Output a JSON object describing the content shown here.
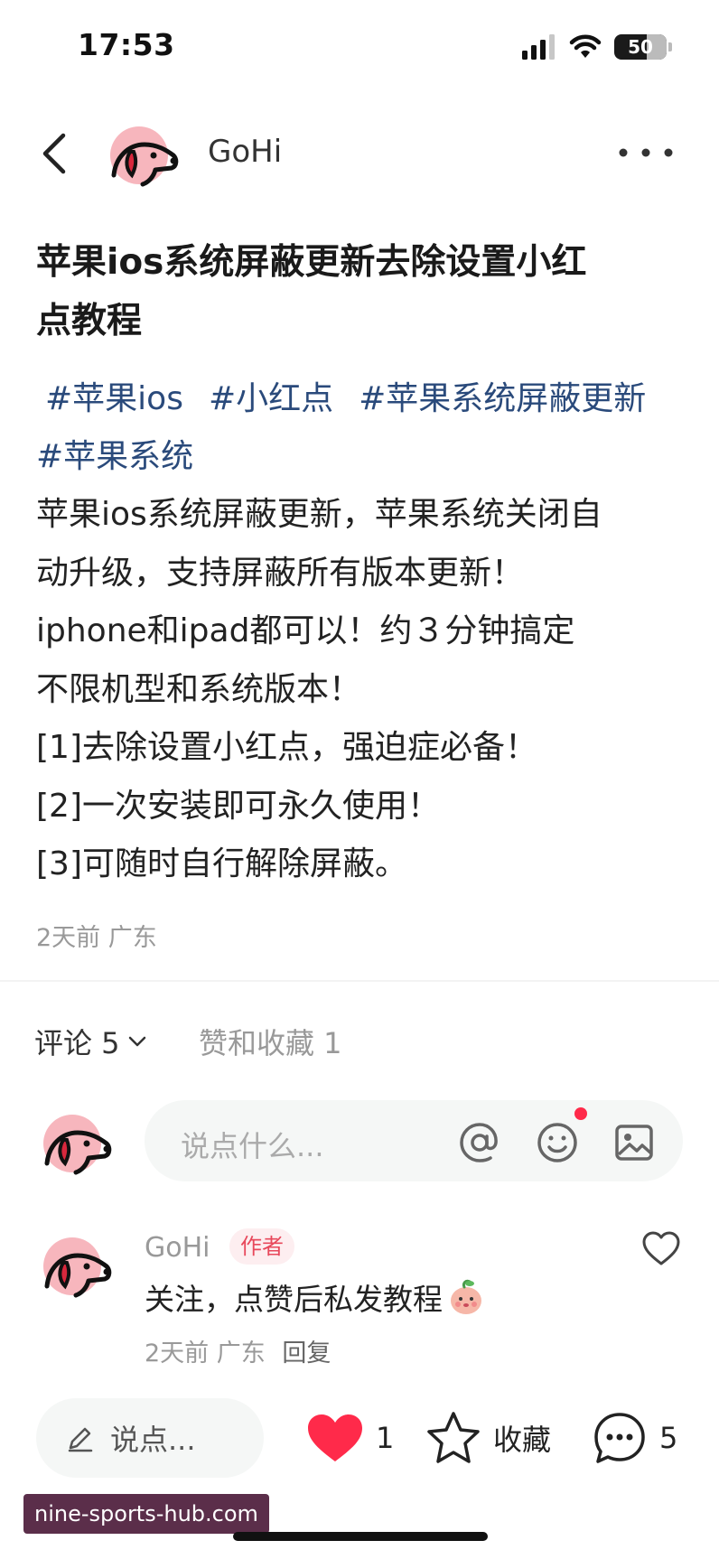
{
  "status": {
    "time": "17:53",
    "battery": "50"
  },
  "nav": {
    "author": "GoHi"
  },
  "post": {
    "title_lines": [
      "苹果ios系统屏蔽更新去除设置小红",
      "点教程"
    ],
    "tags": [
      "#苹果ios",
      "#小红点",
      "#苹果系统屏蔽更新",
      "#苹果系统"
    ],
    "body_lines": [
      "苹果ios系统屏蔽更新，苹果系统关闭自",
      "动升级，支持屏蔽所有版本更新！",
      "iphone和ipad都可以！约３分钟搞定",
      "不限机型和系统版本！",
      "[1]去除设置小红点，强迫症必备！",
      "[2]一次安装即可永久使用！",
      "[3]可随时自行解除屏蔽。"
    ],
    "meta": "2天前 广东"
  },
  "comments_section": {
    "comments_tab": "评论 5",
    "likes_tab": "赞和收藏 1",
    "input_placeholder": "说点什么..."
  },
  "comment": {
    "author": "GoHi",
    "badge": "作者",
    "text": "关注，点赞后私发教程",
    "time_location": "2天前 广东",
    "reply": "回复"
  },
  "bottom_bar": {
    "input_placeholder": "说点...",
    "like_count": "1",
    "collect_label": "收藏",
    "comment_count": "5"
  },
  "watermark": "nine-sports-hub.com",
  "colors": {
    "accent_red": "#ff2a4a",
    "tag_blue": "#2a4a7b",
    "avatar_pink": "#f7b6bd"
  }
}
